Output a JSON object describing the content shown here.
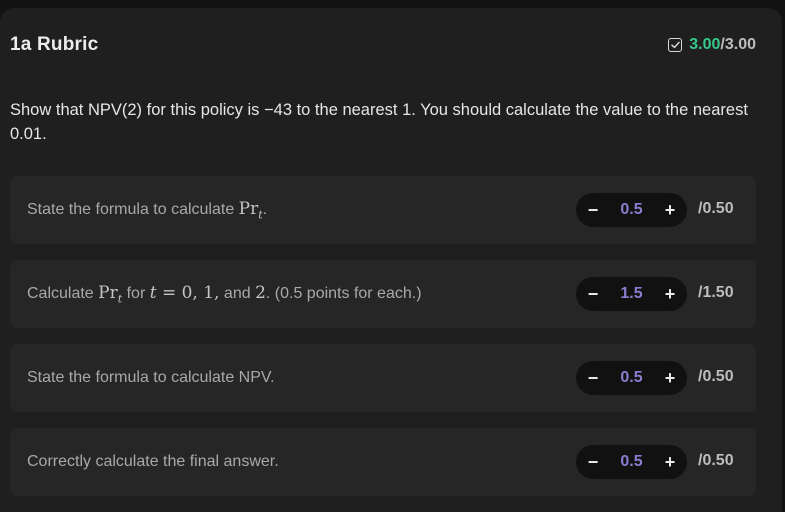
{
  "header": {
    "title": "1a Rubric",
    "score_earned": "3.00",
    "score_total": "/3.00",
    "colors": {
      "earned": "#37c88a"
    }
  },
  "question": {
    "text": "Show that NPV(2) for this policy is −43 to the nearest 1. You should calculate the value to the nearest 0.01."
  },
  "items": [
    {
      "label_before": "State the formula to calculate ",
      "math_1": "Pr",
      "math_1_sub": "t",
      "label_after": ".",
      "value": "0.5",
      "max": "/0.50",
      "minus": "−",
      "plus": "+"
    },
    {
      "label_before": "Calculate ",
      "math_1": "Pr",
      "math_1_sub": "t",
      "label_mid": " for ",
      "math_2_var": "t",
      "math_2_rest": " = 0, 1,",
      "label_mid2": " and ",
      "math_3": "2",
      "label_after": ". (0.5 points for each.)",
      "value": "1.5",
      "max": "/1.50",
      "minus": "−",
      "plus": "+"
    },
    {
      "label": "State the formula to calculate NPV.",
      "value": "0.5",
      "max": "/0.50",
      "minus": "−",
      "plus": "+"
    },
    {
      "label": "Correctly calculate the final answer.",
      "value": "0.5",
      "max": "/0.50",
      "minus": "−",
      "plus": "+"
    }
  ],
  "icons": {
    "score": "checkbox-check-icon"
  }
}
